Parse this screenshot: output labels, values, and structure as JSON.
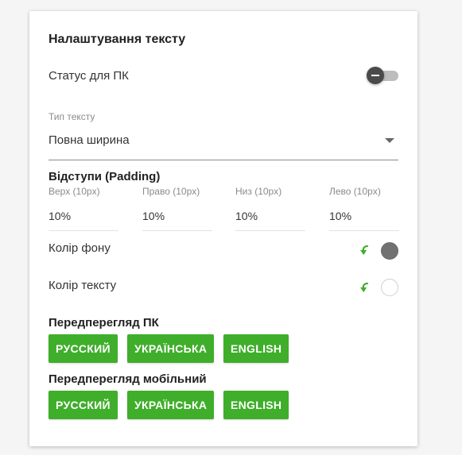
{
  "panel": {
    "title": "Налаштування тексту",
    "status": {
      "label": "Статус для ПК",
      "enabled": false
    },
    "text_type": {
      "label": "Тип тексту",
      "value": "Повна ширина"
    },
    "padding": {
      "title": "Відступи (Padding)",
      "fields": [
        {
          "label": "Верх (10px)",
          "value": "10%"
        },
        {
          "label": "Право (10px)",
          "value": "10%"
        },
        {
          "label": "Низ (10px)",
          "value": "10%"
        },
        {
          "label": "Лево (10px)",
          "value": "10%"
        }
      ]
    },
    "background_color": {
      "label": "Колір фону",
      "color": "#717171"
    },
    "text_color": {
      "label": "Колір тексту",
      "color": "#ffffff"
    },
    "preview_pc": {
      "title": "Передперегляд ПК",
      "buttons": [
        "РУССКИЙ",
        "УКРАЇНСЬКА",
        "ENGLISH"
      ]
    },
    "preview_mobile": {
      "title": "Передперегляд мобільний",
      "buttons": [
        "РУССКИЙ",
        "УКРАЇНСЬКА",
        "ENGLISH"
      ]
    }
  },
  "colors": {
    "accent": "#3fae2a",
    "toggle_knob": "#4a4a4a",
    "toggle_track": "#bdbdbd"
  },
  "icons": {
    "reset": "reset-arrow-icon",
    "dropdown": "caret-down-icon"
  }
}
